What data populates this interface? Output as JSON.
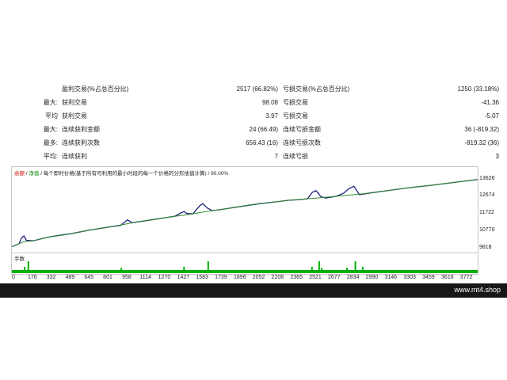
{
  "stats": [
    {
      "label": "",
      "name1": "盈利交易(%占总百分比)",
      "value1": "2517 (66.82%)",
      "name2": "亏损交易(%占总百分比)",
      "value2": "1250 (33.18%)"
    },
    {
      "label": "最大:",
      "name1": "获利交易",
      "value1": "98.08",
      "name2": "亏损交易",
      "value2": "-41.36"
    },
    {
      "label": "平均",
      "name1": "获利交易",
      "value1": "3.97",
      "name2": "亏损交易",
      "value2": "-5.07"
    },
    {
      "label": "最大:",
      "name1": "连续获利金额",
      "value1": "24 (66.49)",
      "name2": "连续亏损金额",
      "value2": "36 (-819.32)"
    },
    {
      "label": "最多:",
      "name1": "连续获利次数",
      "value1": "656.43 (16)",
      "name2": "连续亏损次数",
      "value2": "-819.32 (36)"
    },
    {
      "label": "平均:",
      "name1": "连续获利",
      "value1": "7",
      "name2": "连续亏损",
      "value2": "3"
    }
  ],
  "chart": {
    "header_balance": "余额",
    "header_sep1": " / ",
    "header_equity": "净值",
    "header_desc": " / 每个即时价格(基于所有可利用的最小时段的每一个价格的分形插值计算) / 90.00%",
    "volume_label": "手数",
    "colors": {
      "balance": "#1a237e",
      "equity": "#2e8b2e",
      "volume": "#00b000"
    }
  },
  "chart_data": {
    "type": "line",
    "ylim": [
      9818,
      14000
    ],
    "y_ticks": [
      "13626",
      "12674",
      "11722",
      "10770",
      "9818"
    ],
    "x_ticks": [
      "0",
      "176",
      "332",
      "489",
      "645",
      "801",
      "958",
      "1114",
      "1270",
      "1427",
      "1583",
      "1739",
      "1896",
      "2052",
      "2208",
      "2365",
      "2521",
      "2677",
      "2834",
      "2990",
      "3146",
      "3303",
      "3459",
      "3616",
      "3772"
    ],
    "series": [
      {
        "x": [
          0,
          60,
          100,
          176,
          250,
          332,
          420,
          489,
          560,
          645,
          730,
          801,
          880,
          958,
          1040,
          1114,
          1190,
          1270,
          1350,
          1427,
          1500,
          1583,
          1660,
          1739,
          1820,
          1896,
          1970,
          2052,
          2130,
          2208,
          2290,
          2365,
          2440,
          2521,
          2600,
          2677,
          2750,
          2834,
          2910,
          2990,
          3070,
          3146,
          3220,
          3303,
          3380,
          3459,
          3540,
          3616,
          3700,
          3772,
          3860
        ],
        "y": [
          9960,
          10130,
          10250,
          10290,
          10410,
          10530,
          10600,
          10680,
          10780,
          10880,
          10980,
          11040,
          11140,
          11230,
          11330,
          11400,
          11470,
          11560,
          11640,
          11700,
          11780,
          11870,
          11950,
          12020,
          12100,
          12180,
          12260,
          12330,
          12400,
          12450,
          12520,
          12550,
          12600,
          12640,
          12690,
          12730,
          12780,
          12830,
          12880,
          12940,
          13010,
          13080,
          13150,
          13220,
          13280,
          13330,
          13400,
          13460,
          13530,
          13590,
          13660
        ]
      },
      {
        "x": [
          0,
          60,
          80,
          100,
          120,
          176,
          250,
          332,
          489,
          645,
          801,
          900,
          958,
          1000,
          1040,
          1114,
          1270,
          1350,
          1400,
          1427,
          1450,
          1500,
          1560,
          1583,
          1620,
          1660,
          1739,
          1896,
          2052,
          2208,
          2290,
          2365,
          2450,
          2490,
          2521,
          2560,
          2600,
          2677,
          2700,
          2750,
          2790,
          2834,
          2880,
          2990,
          3146,
          3303,
          3459,
          3616,
          3772,
          3860
        ],
        "y": [
          9960,
          10130,
          10450,
          10560,
          10320,
          10290,
          10410,
          10530,
          10680,
          10880,
          11040,
          11140,
          11440,
          11280,
          11330,
          11400,
          11560,
          11640,
          11820,
          11900,
          11790,
          11780,
          12240,
          12330,
          12090,
          11950,
          12020,
          12180,
          12330,
          12450,
          12520,
          12550,
          12600,
          12960,
          13050,
          12720,
          12640,
          12730,
          12770,
          12910,
          13150,
          13290,
          12830,
          12940,
          13080,
          13220,
          13330,
          13460,
          13590,
          13660
        ]
      }
    ],
    "volume": {
      "x": [
        100,
        130,
        900,
        1420,
        1620,
        2480,
        2540,
        2560,
        2770,
        2840,
        2900
      ],
      "y": [
        0.5,
        1,
        0.4,
        0.5,
        1,
        0.5,
        1,
        0.4,
        0.4,
        1,
        0.5
      ]
    },
    "xlim": [
      0,
      3860
    ]
  },
  "footer": {
    "site": "www.mt4.shop"
  }
}
